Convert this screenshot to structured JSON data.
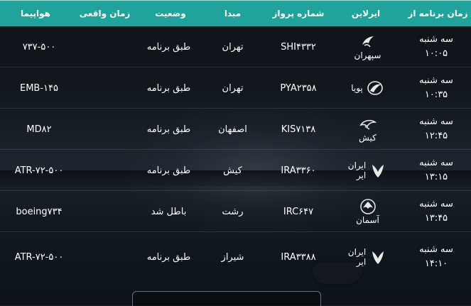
{
  "header": {
    "scheduled_time": "زمان برنامه از",
    "airline": "ایرلاین",
    "flight_number": "شماره پرواز",
    "origin": "مبدا",
    "status": "وضعیت",
    "actual_time": "زمان واقعی",
    "aircraft": "هواپیما"
  },
  "flights": [
    {
      "day": "سه شنبه",
      "time": "۱۰:۰۵",
      "airline": "سپهران",
      "airline_line1": "",
      "airline_line2": "",
      "logo": "sepehran-bird-icon",
      "number": "SHI۴۳۳۲",
      "origin": "تهران",
      "status": "طبق برنامه",
      "actual": "",
      "aircraft": "۷۳۷-۵۰۰"
    },
    {
      "day": "سه شنبه",
      "time": "۱۰:۳۵",
      "airline": "پویا",
      "airline_line1": "",
      "airline_line2": "",
      "logo": "pouya-swoosh-icon",
      "number": "PYA۲۳۵۸",
      "origin": "تهران",
      "status": "طبق برنامه",
      "actual": "",
      "aircraft": "EMB-۱۴۵"
    },
    {
      "day": "سه شنبه",
      "time": "۱۲:۴۵",
      "airline": "کیش",
      "airline_line1": "",
      "airline_line2": "",
      "logo": "kish-bird-icon",
      "number": "KIS۷۱۳۸",
      "origin": "اصفهان",
      "status": "طبق برنامه",
      "actual": "",
      "aircraft": "MD۸۲"
    },
    {
      "day": "سه شنبه",
      "time": "۱۳:۱۵",
      "airline": "",
      "airline_line1": "ایران",
      "airline_line2": "ایر",
      "logo": "homa-bird-icon",
      "number": "IRA۳۳۶۰",
      "origin": "کیش",
      "status": "طبق برنامه",
      "actual": "",
      "aircraft": "ATR-۷۲-۵۰۰"
    },
    {
      "day": "سه شنبه",
      "time": "۱۳:۴۵",
      "airline": "آسمان",
      "airline_line1": "",
      "airline_line2": "",
      "logo": "aseman-wings-icon",
      "number": "IRC۶۴۷",
      "origin": "رشت",
      "status": "باطل شد",
      "actual": "",
      "aircraft": "boeing۷۳۴"
    },
    {
      "day": "سه شنبه",
      "time": "۱۴:۱۰",
      "airline": "",
      "airline_line1": "ایران",
      "airline_line2": "ایر",
      "logo": "homa-bird-icon",
      "number": "IRA۳۳۸۸",
      "origin": "شیراز",
      "status": "طبق برنامه",
      "actual": "",
      "aircraft": "ATR-۷۲-۵۰۰"
    }
  ],
  "colors": {
    "header": "#20a39b",
    "text": "#ffffff"
  }
}
